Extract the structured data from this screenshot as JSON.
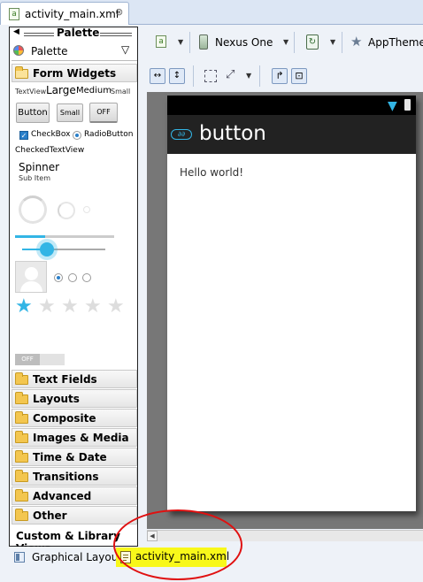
{
  "editor": {
    "file_tab_label": "activity_main.xml",
    "close_glyph": "⊗"
  },
  "palette": {
    "title": "Palette",
    "dropdown_label": "Palette",
    "form_widgets": {
      "label": "Form Widgets",
      "textview_label": "TextView",
      "large_label": "Large",
      "medium_label": "Medium",
      "small_label": "Small",
      "button_label": "Button",
      "small_button_label": "Small",
      "toggle_label": "OFF",
      "checkbox_label": "CheckBox",
      "radiobutton_label": "RadioButton",
      "checked_textview_label": "CheckedTextView",
      "spinner_label": "Spinner",
      "spinner_subitem": "Sub Item",
      "switch_label": "OFF"
    },
    "categories": [
      {
        "label": "Text Fields"
      },
      {
        "label": "Layouts"
      },
      {
        "label": "Composite"
      },
      {
        "label": "Images & Media"
      },
      {
        "label": "Time & Date"
      },
      {
        "label": "Transitions"
      },
      {
        "label": "Advanced"
      },
      {
        "label": "Other"
      }
    ],
    "custom_views_label": "Custom & Library Views"
  },
  "toolbar": {
    "device_label": "Nexus One",
    "theme_label": "AppTheme"
  },
  "device": {
    "action_bar_title": "button",
    "content_text": "Hello world!"
  },
  "bottom_tabs": {
    "graphical_layout_label": "Graphical Layout",
    "xml_tab_label": "activity_main.xml"
  },
  "colors": {
    "accent": "#2a7fc9",
    "highlight": "#f8f81a",
    "annotation": "#e01010",
    "holo_blue": "#33b5e5"
  }
}
